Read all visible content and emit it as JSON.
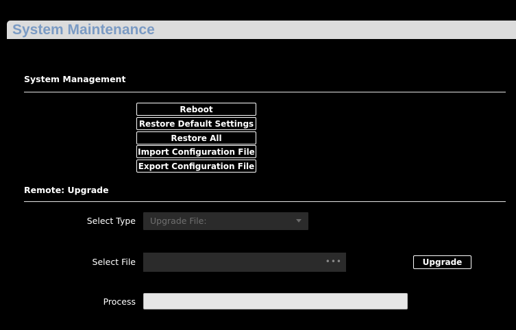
{
  "header": {
    "title": "System Maintenance"
  },
  "system_management": {
    "section_title": "System Management",
    "buttons": [
      {
        "label": "Reboot"
      },
      {
        "label": "Restore Default Settings"
      },
      {
        "label": "Restore All"
      },
      {
        "label": "Import Configuration File"
      },
      {
        "label": "Export Configuration File"
      }
    ]
  },
  "remote_upgrade": {
    "section_title": "Remote: Upgrade",
    "select_type": {
      "label": "Select Type",
      "value": "Upgrade File:"
    },
    "select_file": {
      "label": "Select File",
      "value": "",
      "browse_icon": "ellipsis-icon"
    },
    "upgrade_button": {
      "label": "Upgrade"
    },
    "process": {
      "label": "Process",
      "progress": 0
    }
  },
  "colors": {
    "title_bar_bg": "#dcdcdc",
    "title_text": "#7b9bc4",
    "page_bg": "#000000",
    "input_bg": "#2b2b2b",
    "progress_bg": "#e6e6e6"
  }
}
